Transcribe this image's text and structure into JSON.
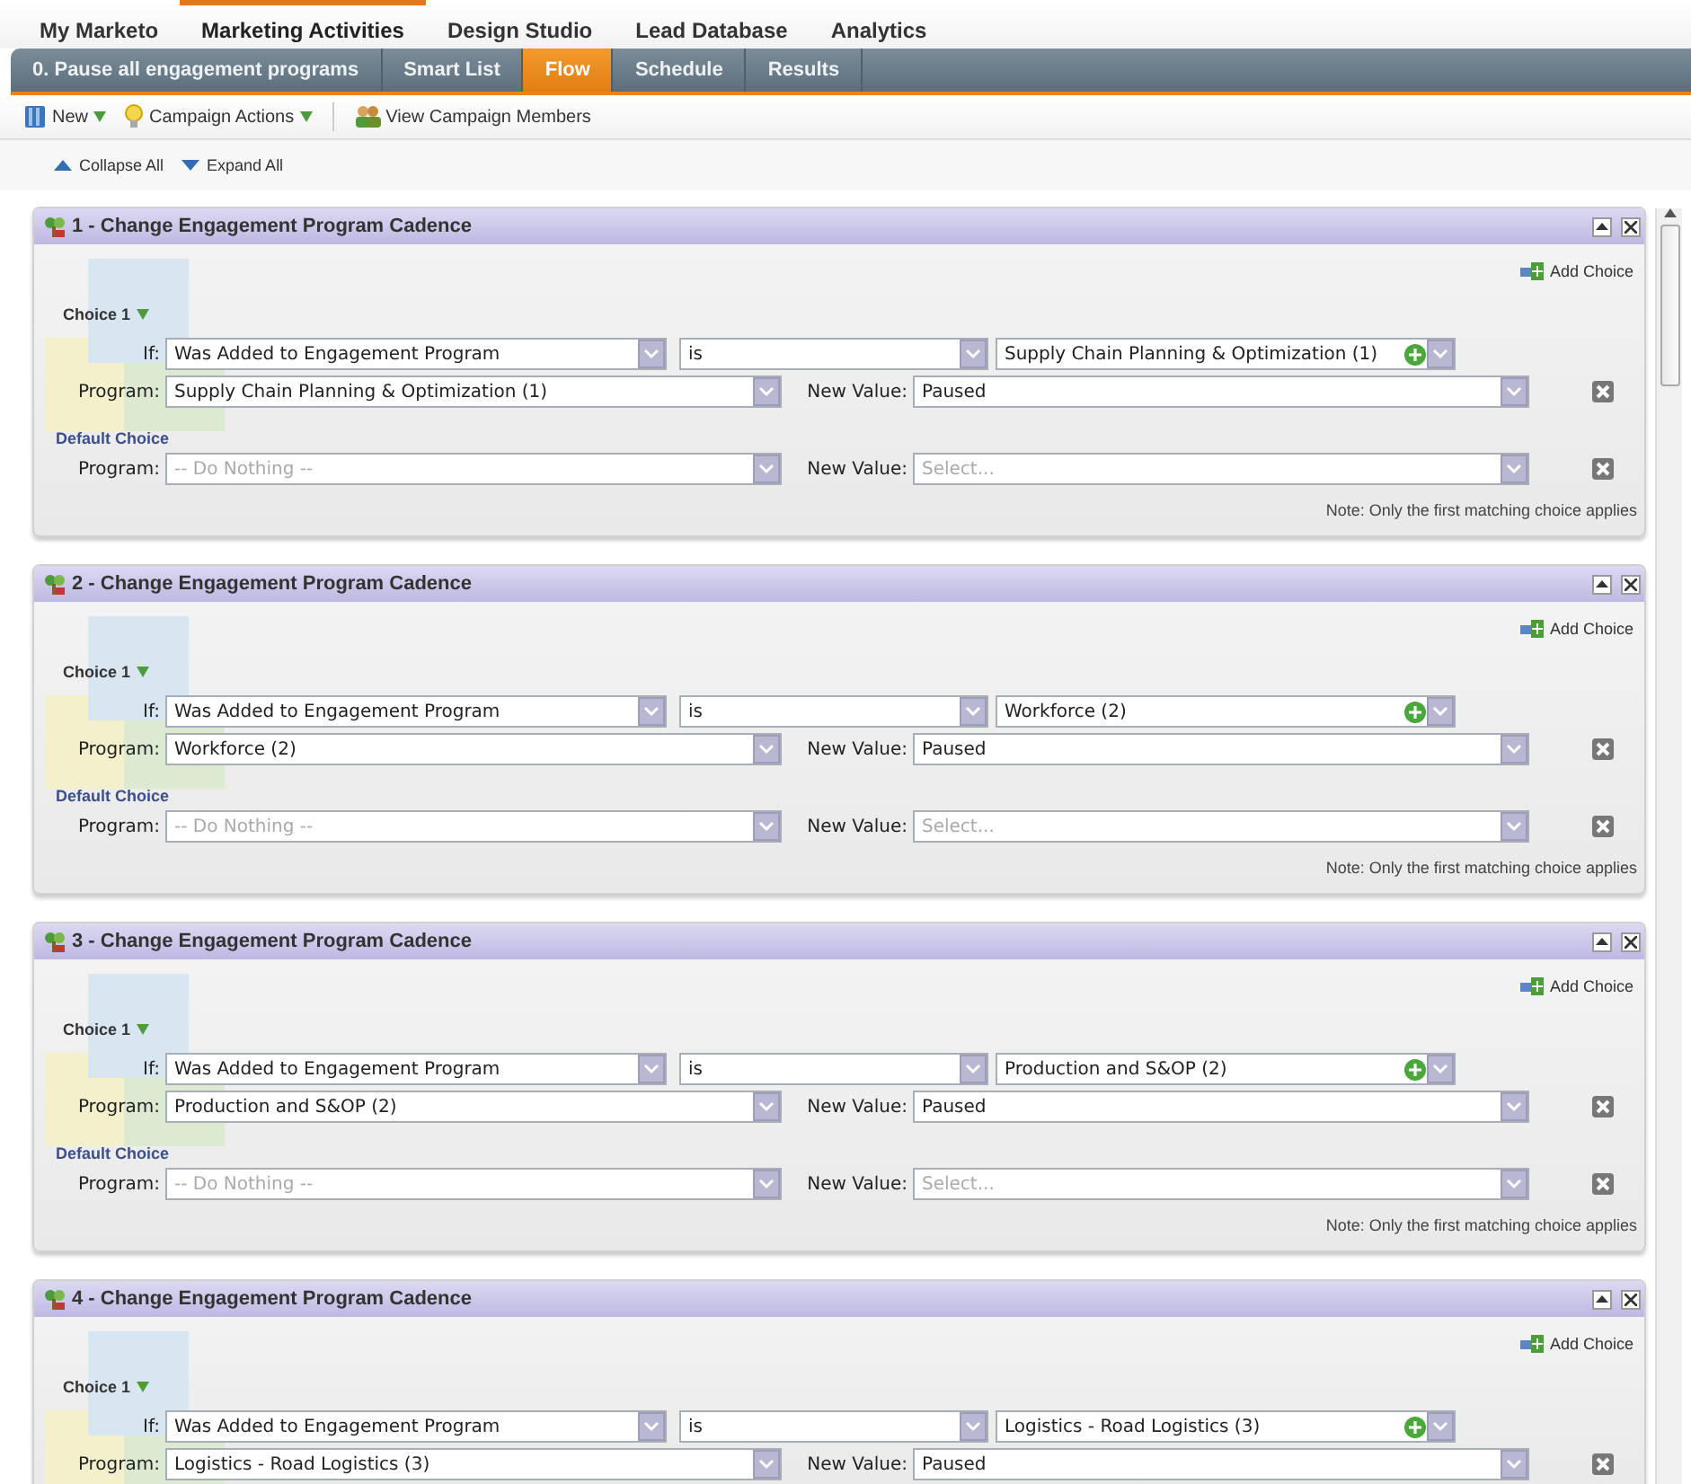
{
  "main_tabs": [
    {
      "label": "My Marketo",
      "selected": false
    },
    {
      "label": "Marketing Activities",
      "selected": true
    },
    {
      "label": "Design Studio",
      "selected": false
    },
    {
      "label": "Lead Database",
      "selected": false
    },
    {
      "label": "Analytics",
      "selected": false
    }
  ],
  "sub_tabs": [
    {
      "label": "0. Pause all engagement programs",
      "selected": false
    },
    {
      "label": "Smart List",
      "selected": false
    },
    {
      "label": "Flow",
      "selected": true
    },
    {
      "label": "Schedule",
      "selected": false
    },
    {
      "label": "Results",
      "selected": false
    }
  ],
  "toolbar": [
    {
      "label": "New",
      "kind": "menu"
    },
    {
      "label": "Campaign Actions",
      "kind": "menu"
    },
    {
      "label": "View Campaign Members",
      "kind": "button"
    }
  ],
  "tree_controls": [
    {
      "label": "Collapse All",
      "kind": "collapse"
    },
    {
      "label": "Expand All",
      "kind": "expand"
    }
  ],
  "flow_steps": [
    {
      "title": "1 - Change Engagement Program Cadence",
      "add_choice": "Add Choice",
      "choices": [
        {
          "label": "Choice 1",
          "if_label": "If:",
          "condition": "Was Added to Engagement Program",
          "operator": "is",
          "value": "Supply Chain Planning & Optimization (1)",
          "program_label": "Program:",
          "program": "Supply Chain Planning & Optimization (1)",
          "new_value_label": "New Value:",
          "new_value": "Paused"
        }
      ],
      "default_choice": {
        "label": "Default Choice",
        "program_label": "Program:",
        "program_placeholder": "-- Do Nothing --",
        "new_value_label": "New Value:",
        "new_value_placeholder": "Select..."
      },
      "note": "Note: Only the first matching choice applies"
    },
    {
      "title": "2 - Change Engagement Program Cadence",
      "add_choice": "Add Choice",
      "choices": [
        {
          "label": "Choice 1",
          "if_label": "If:",
          "condition": "Was Added to Engagement Program",
          "operator": "is",
          "value": "Workforce (2)",
          "program_label": "Program:",
          "program": "Workforce (2)",
          "new_value_label": "New Value:",
          "new_value": "Paused"
        }
      ],
      "default_choice": {
        "label": "Default Choice",
        "program_label": "Program:",
        "program_placeholder": "-- Do Nothing --",
        "new_value_label": "New Value:",
        "new_value_placeholder": "Select..."
      },
      "note": "Note: Only the first matching choice applies"
    },
    {
      "title": "3 - Change Engagement Program Cadence",
      "add_choice": "Add Choice",
      "choices": [
        {
          "label": "Choice 1",
          "if_label": "If:",
          "condition": "Was Added to Engagement Program",
          "operator": "is",
          "value": "Production and S&OP (2)",
          "program_label": "Program:",
          "program": "Production and S&OP (2)",
          "new_value_label": "New Value:",
          "new_value": "Paused"
        }
      ],
      "default_choice": {
        "label": "Default Choice",
        "program_label": "Program:",
        "program_placeholder": "-- Do Nothing --",
        "new_value_label": "New Value:",
        "new_value_placeholder": "Select..."
      },
      "note": "Note: Only the first matching choice applies"
    },
    {
      "title": "4 - Change Engagement Program Cadence",
      "add_choice": "Add Choice",
      "choices": [
        {
          "label": "Choice 1",
          "if_label": "If:",
          "condition": "Was Added to Engagement Program",
          "operator": "is",
          "value": "Logistics - Road Logistics (3)",
          "program_label": "Program:",
          "program": "Logistics - Road Logistics (3)",
          "new_value_label": "New Value:",
          "new_value": "Paused"
        }
      ]
    }
  ]
}
